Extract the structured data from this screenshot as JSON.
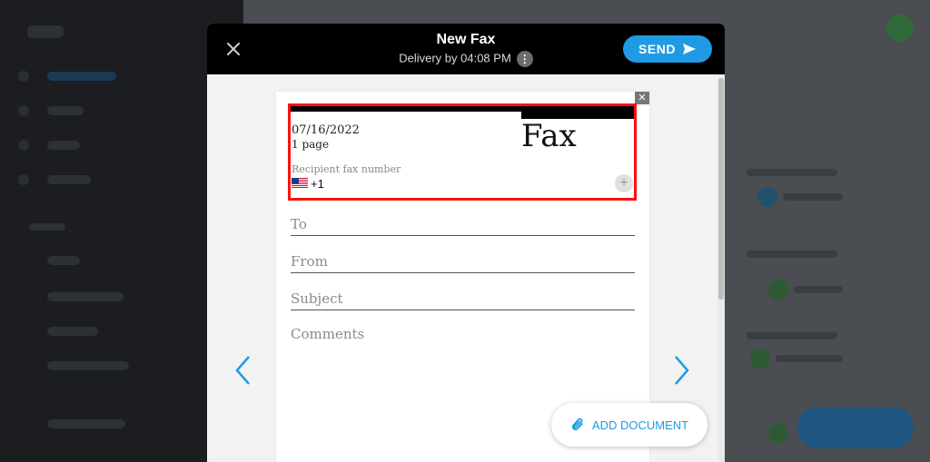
{
  "modal": {
    "title": "New Fax",
    "subtitle": "Delivery by 04:08 PM",
    "info_glyph": "⋮",
    "send_label": "SEND",
    "close_glyph": "✕"
  },
  "cover": {
    "date": "07/16/2022",
    "pages": "1 page",
    "heading": "Fax",
    "recipient_label": "Recipient fax number",
    "country_code": "+1",
    "plus_glyph": "+"
  },
  "fields": {
    "to": "To",
    "from": "From",
    "subject": "Subject",
    "comments": "Comments"
  },
  "actions": {
    "add_document": "ADD DOCUMENT",
    "page_close_glyph": "✕"
  },
  "colors": {
    "accent": "#1f9be3",
    "highlight": "#ff1010",
    "header_bg": "#000000"
  },
  "icons": [
    "close-icon",
    "info-icon",
    "send-arrow-icon",
    "us-flag-icon",
    "plus-icon",
    "chevron-left-icon",
    "chevron-right-icon",
    "paperclip-icon"
  ]
}
